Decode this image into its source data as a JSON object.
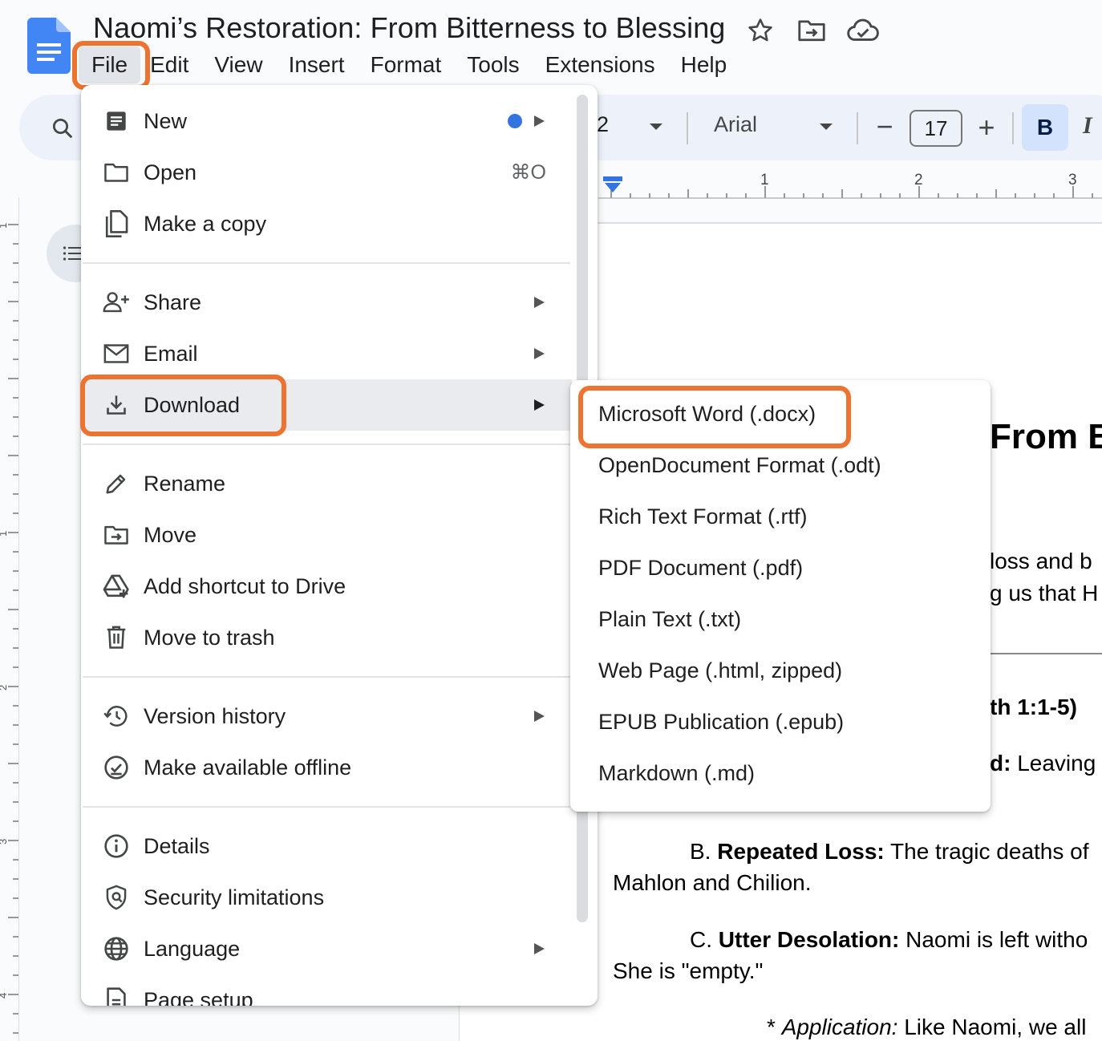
{
  "app": {
    "title": "Naomi’s Restoration: From Bitterness to Blessing",
    "brand_color": "#4285f4",
    "highlight_color": "#ec7330",
    "title_icons": [
      "star-icon",
      "move-folder-icon",
      "cloud-saved-icon"
    ]
  },
  "menubar": {
    "items": [
      "File",
      "Edit",
      "View",
      "Insert",
      "Format",
      "Tools",
      "Extensions",
      "Help"
    ],
    "active": "File"
  },
  "toolbar": {
    "style_value": "2",
    "font_value": "Arial",
    "font_size": "17",
    "minus_label": "−",
    "plus_label": "+",
    "bold_label": "B",
    "italic_label": "I",
    "bold_active": true
  },
  "ruler": {
    "top_numbers": [
      "1",
      "2",
      "3"
    ],
    "left_numbers": [
      "1",
      "1",
      "2",
      "3",
      "4"
    ]
  },
  "file_menu": {
    "new": {
      "label": "New",
      "icon": "document-icon",
      "has_dot": true
    },
    "open": {
      "label": "Open",
      "icon": "folder-icon",
      "shortcut": "⌘O"
    },
    "copy": {
      "label": "Make a copy",
      "icon": "copy-icon"
    },
    "share": {
      "label": "Share",
      "icon": "add-person-icon"
    },
    "email": {
      "label": "Email",
      "icon": "mail-icon"
    },
    "download": {
      "label": "Download",
      "icon": "download-icon"
    },
    "rename": {
      "label": "Rename",
      "icon": "pencil-icon"
    },
    "move": {
      "label": "Move",
      "icon": "move-folder-icon"
    },
    "shortcut": {
      "label": "Add shortcut to Drive",
      "icon": "drive-shortcut-icon"
    },
    "trash": {
      "label": "Move to trash",
      "icon": "trash-icon"
    },
    "version": {
      "label": "Version history",
      "icon": "history-icon"
    },
    "offline": {
      "label": "Make available offline",
      "icon": "offline-check-icon"
    },
    "details": {
      "label": "Details",
      "icon": "info-icon"
    },
    "security": {
      "label": "Security limitations",
      "icon": "shield-icon"
    },
    "language": {
      "label": "Language",
      "icon": "globe-icon"
    },
    "page_setup": {
      "label": "Page setup",
      "icon": "page-setup-icon"
    }
  },
  "download_submenu": {
    "items": [
      "Microsoft Word (.docx)",
      "OpenDocument Format (.odt)",
      "Rich Text Format (.rtf)",
      "PDF Document (.pdf)",
      "Plain Text (.txt)",
      "Web Page (.html, zipped)",
      "EPUB Publication (.epub)",
      "Markdown (.md)"
    ]
  },
  "document": {
    "heading_fragment": "From B",
    "intro_line1": "loss and b",
    "intro_line2": "g us that H",
    "section_ref": "th 1:1-5)",
    "point_a_label": "d:",
    "point_a_text": "Leaving",
    "point_b_prefix": "B.",
    "point_b_label": "Repeated Loss:",
    "point_b_text": "The tragic deaths of",
    "point_b_cont": "Mahlon and Chilion.",
    "point_c_prefix": "C.",
    "point_c_label": "Utter Desolation:",
    "point_c_text": "Naomi is left witho",
    "point_c_cont": "She is \"empty.\"",
    "application_prefix": "*",
    "application_label": "Application:",
    "application_text": "Like Naomi, we all"
  }
}
